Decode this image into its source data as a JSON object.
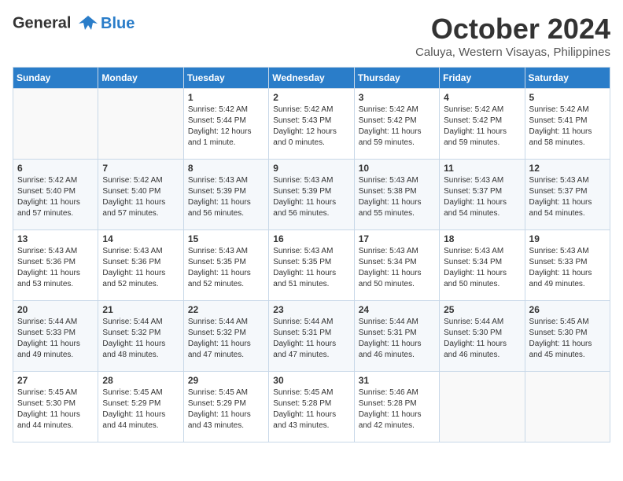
{
  "header": {
    "logo_line1": "General",
    "logo_line2": "Blue",
    "month_title": "October 2024",
    "subtitle": "Caluya, Western Visayas, Philippines"
  },
  "days_of_week": [
    "Sunday",
    "Monday",
    "Tuesday",
    "Wednesday",
    "Thursday",
    "Friday",
    "Saturday"
  ],
  "weeks": [
    [
      {
        "day": "",
        "sunrise": "",
        "sunset": "",
        "daylight": ""
      },
      {
        "day": "",
        "sunrise": "",
        "sunset": "",
        "daylight": ""
      },
      {
        "day": "1",
        "sunrise": "Sunrise: 5:42 AM",
        "sunset": "Sunset: 5:44 PM",
        "daylight": "Daylight: 12 hours and 1 minute."
      },
      {
        "day": "2",
        "sunrise": "Sunrise: 5:42 AM",
        "sunset": "Sunset: 5:43 PM",
        "daylight": "Daylight: 12 hours and 0 minutes."
      },
      {
        "day": "3",
        "sunrise": "Sunrise: 5:42 AM",
        "sunset": "Sunset: 5:42 PM",
        "daylight": "Daylight: 11 hours and 59 minutes."
      },
      {
        "day": "4",
        "sunrise": "Sunrise: 5:42 AM",
        "sunset": "Sunset: 5:42 PM",
        "daylight": "Daylight: 11 hours and 59 minutes."
      },
      {
        "day": "5",
        "sunrise": "Sunrise: 5:42 AM",
        "sunset": "Sunset: 5:41 PM",
        "daylight": "Daylight: 11 hours and 58 minutes."
      }
    ],
    [
      {
        "day": "6",
        "sunrise": "Sunrise: 5:42 AM",
        "sunset": "Sunset: 5:40 PM",
        "daylight": "Daylight: 11 hours and 57 minutes."
      },
      {
        "day": "7",
        "sunrise": "Sunrise: 5:42 AM",
        "sunset": "Sunset: 5:40 PM",
        "daylight": "Daylight: 11 hours and 57 minutes."
      },
      {
        "day": "8",
        "sunrise": "Sunrise: 5:43 AM",
        "sunset": "Sunset: 5:39 PM",
        "daylight": "Daylight: 11 hours and 56 minutes."
      },
      {
        "day": "9",
        "sunrise": "Sunrise: 5:43 AM",
        "sunset": "Sunset: 5:39 PM",
        "daylight": "Daylight: 11 hours and 56 minutes."
      },
      {
        "day": "10",
        "sunrise": "Sunrise: 5:43 AM",
        "sunset": "Sunset: 5:38 PM",
        "daylight": "Daylight: 11 hours and 55 minutes."
      },
      {
        "day": "11",
        "sunrise": "Sunrise: 5:43 AM",
        "sunset": "Sunset: 5:37 PM",
        "daylight": "Daylight: 11 hours and 54 minutes."
      },
      {
        "day": "12",
        "sunrise": "Sunrise: 5:43 AM",
        "sunset": "Sunset: 5:37 PM",
        "daylight": "Daylight: 11 hours and 54 minutes."
      }
    ],
    [
      {
        "day": "13",
        "sunrise": "Sunrise: 5:43 AM",
        "sunset": "Sunset: 5:36 PM",
        "daylight": "Daylight: 11 hours and 53 minutes."
      },
      {
        "day": "14",
        "sunrise": "Sunrise: 5:43 AM",
        "sunset": "Sunset: 5:36 PM",
        "daylight": "Daylight: 11 hours and 52 minutes."
      },
      {
        "day": "15",
        "sunrise": "Sunrise: 5:43 AM",
        "sunset": "Sunset: 5:35 PM",
        "daylight": "Daylight: 11 hours and 52 minutes."
      },
      {
        "day": "16",
        "sunrise": "Sunrise: 5:43 AM",
        "sunset": "Sunset: 5:35 PM",
        "daylight": "Daylight: 11 hours and 51 minutes."
      },
      {
        "day": "17",
        "sunrise": "Sunrise: 5:43 AM",
        "sunset": "Sunset: 5:34 PM",
        "daylight": "Daylight: 11 hours and 50 minutes."
      },
      {
        "day": "18",
        "sunrise": "Sunrise: 5:43 AM",
        "sunset": "Sunset: 5:34 PM",
        "daylight": "Daylight: 11 hours and 50 minutes."
      },
      {
        "day": "19",
        "sunrise": "Sunrise: 5:43 AM",
        "sunset": "Sunset: 5:33 PM",
        "daylight": "Daylight: 11 hours and 49 minutes."
      }
    ],
    [
      {
        "day": "20",
        "sunrise": "Sunrise: 5:44 AM",
        "sunset": "Sunset: 5:33 PM",
        "daylight": "Daylight: 11 hours and 49 minutes."
      },
      {
        "day": "21",
        "sunrise": "Sunrise: 5:44 AM",
        "sunset": "Sunset: 5:32 PM",
        "daylight": "Daylight: 11 hours and 48 minutes."
      },
      {
        "day": "22",
        "sunrise": "Sunrise: 5:44 AM",
        "sunset": "Sunset: 5:32 PM",
        "daylight": "Daylight: 11 hours and 47 minutes."
      },
      {
        "day": "23",
        "sunrise": "Sunrise: 5:44 AM",
        "sunset": "Sunset: 5:31 PM",
        "daylight": "Daylight: 11 hours and 47 minutes."
      },
      {
        "day": "24",
        "sunrise": "Sunrise: 5:44 AM",
        "sunset": "Sunset: 5:31 PM",
        "daylight": "Daylight: 11 hours and 46 minutes."
      },
      {
        "day": "25",
        "sunrise": "Sunrise: 5:44 AM",
        "sunset": "Sunset: 5:30 PM",
        "daylight": "Daylight: 11 hours and 46 minutes."
      },
      {
        "day": "26",
        "sunrise": "Sunrise: 5:45 AM",
        "sunset": "Sunset: 5:30 PM",
        "daylight": "Daylight: 11 hours and 45 minutes."
      }
    ],
    [
      {
        "day": "27",
        "sunrise": "Sunrise: 5:45 AM",
        "sunset": "Sunset: 5:30 PM",
        "daylight": "Daylight: 11 hours and 44 minutes."
      },
      {
        "day": "28",
        "sunrise": "Sunrise: 5:45 AM",
        "sunset": "Sunset: 5:29 PM",
        "daylight": "Daylight: 11 hours and 44 minutes."
      },
      {
        "day": "29",
        "sunrise": "Sunrise: 5:45 AM",
        "sunset": "Sunset: 5:29 PM",
        "daylight": "Daylight: 11 hours and 43 minutes."
      },
      {
        "day": "30",
        "sunrise": "Sunrise: 5:45 AM",
        "sunset": "Sunset: 5:28 PM",
        "daylight": "Daylight: 11 hours and 43 minutes."
      },
      {
        "day": "31",
        "sunrise": "Sunrise: 5:46 AM",
        "sunset": "Sunset: 5:28 PM",
        "daylight": "Daylight: 11 hours and 42 minutes."
      },
      {
        "day": "",
        "sunrise": "",
        "sunset": "",
        "daylight": ""
      },
      {
        "day": "",
        "sunrise": "",
        "sunset": "",
        "daylight": ""
      }
    ]
  ]
}
